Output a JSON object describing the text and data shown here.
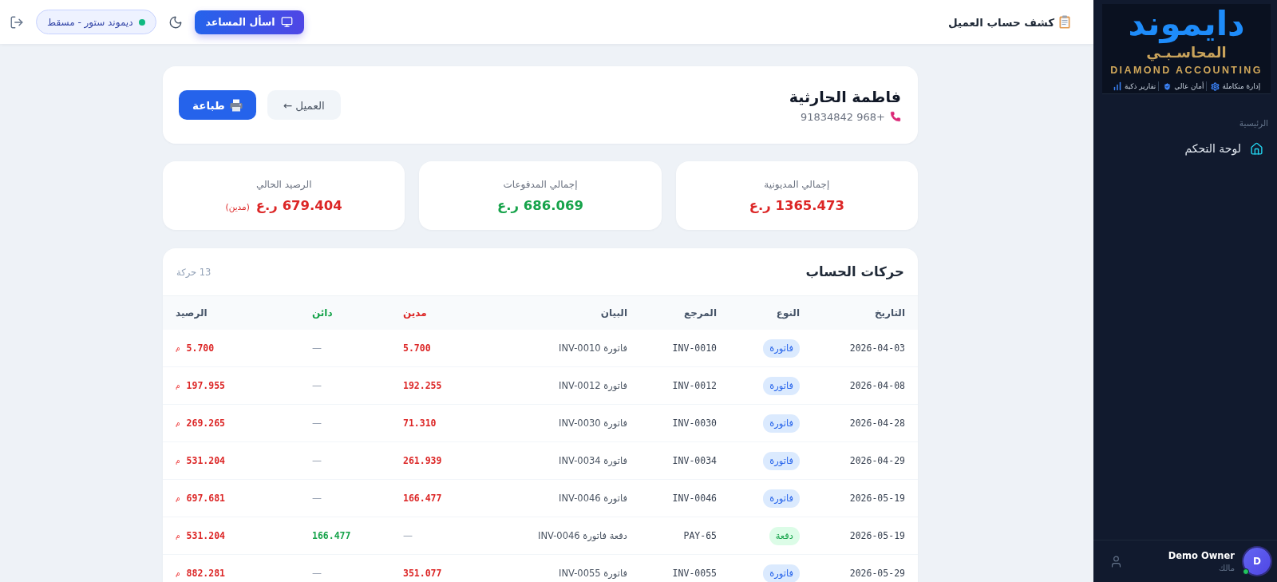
{
  "topbar": {
    "title": "كشف حساب العميل",
    "assistant_button": "اسأل المساعد",
    "store": "ديموند ستور - مسقط"
  },
  "sidebar": {
    "logo": {
      "title": "دايموند",
      "subtitle": "المحاسـبـي",
      "english_name": "DIAMOND ACCOUNTING",
      "features": [
        {
          "kind": "gear",
          "label": "إدارة متكاملة"
        },
        {
          "kind": "shield",
          "label": "أمان عالي"
        },
        {
          "kind": "chart",
          "label": "تقارير ذكية"
        }
      ]
    },
    "section_label": "الرئيسية",
    "items": [
      {
        "label": "لوحة التحكم",
        "selected": false
      }
    ],
    "user": {
      "initial": "D",
      "name": "Demo Owner",
      "role": "مالك",
      "online": true
    }
  },
  "customer": {
    "name": "فاطمة الحارثية",
    "phone": "+968 91834842",
    "back_button": "العميل ←",
    "print_button": "طباعة"
  },
  "summary": [
    {
      "label": "إجمالي المديونية",
      "value": "1365.473 ر.ع",
      "kind": "debit"
    },
    {
      "label": "إجمالي المدفوعات",
      "value": "686.069 ر.ع",
      "kind": "credit"
    },
    {
      "label": "الرصيد الحالي",
      "value": "679.404 ر.ع",
      "kind": "debit",
      "note": "(مدين)"
    }
  ],
  "transactions": {
    "title": "حركات الحساب",
    "count": "13 حركة",
    "columns": [
      {
        "label": "التاريخ",
        "kind": "date"
      },
      {
        "label": "النوع",
        "kind": "type"
      },
      {
        "label": "المرجع",
        "kind": "ref"
      },
      {
        "label": "البيان",
        "kind": "description"
      },
      {
        "label": "مدين",
        "kind": "debit"
      },
      {
        "label": "دائن",
        "kind": "credit"
      },
      {
        "label": "الرصيد",
        "kind": "balance"
      }
    ],
    "rows": [
      {
        "kind": "invoice",
        "date": "2026-04-03",
        "type": "فاتورة",
        "ref": "INV-0010",
        "description": "فاتورة INV-0010",
        "debit": "5.700",
        "credit": "—",
        "balance": {
          "value": "5.700",
          "suffix": "م"
        }
      },
      {
        "kind": "invoice",
        "date": "2026-04-08",
        "type": "فاتورة",
        "ref": "INV-0012",
        "description": "فاتورة INV-0012",
        "debit": "192.255",
        "credit": "—",
        "balance": {
          "value": "197.955",
          "suffix": "م"
        }
      },
      {
        "kind": "invoice",
        "date": "2026-04-28",
        "type": "فاتورة",
        "ref": "INV-0030",
        "description": "فاتورة INV-0030",
        "debit": "71.310",
        "credit": "—",
        "balance": {
          "value": "269.265",
          "suffix": "م"
        }
      },
      {
        "kind": "invoice",
        "date": "2026-04-29",
        "type": "فاتورة",
        "ref": "INV-0034",
        "description": "فاتورة INV-0034",
        "debit": "261.939",
        "credit": "—",
        "balance": {
          "value": "531.204",
          "suffix": "م"
        }
      },
      {
        "kind": "invoice",
        "date": "2026-05-19",
        "type": "فاتورة",
        "ref": "INV-0046",
        "description": "فاتورة INV-0046",
        "debit": "166.477",
        "credit": "—",
        "balance": {
          "value": "697.681",
          "suffix": "م"
        }
      },
      {
        "kind": "payment",
        "date": "2026-05-19",
        "type": "دفعة",
        "ref": "PAY-65",
        "description": "دفعة فاتورة INV-0046",
        "debit": "—",
        "credit": "166.477",
        "balance": {
          "value": "531.204",
          "suffix": "م"
        }
      },
      {
        "kind": "invoice",
        "date": "2026-05-29",
        "type": "فاتورة",
        "ref": "INV-0055",
        "description": "فاتورة INV-0055",
        "debit": "351.077",
        "credit": "—",
        "balance": {
          "value": "882.281",
          "suffix": "م"
        }
      }
    ]
  }
}
